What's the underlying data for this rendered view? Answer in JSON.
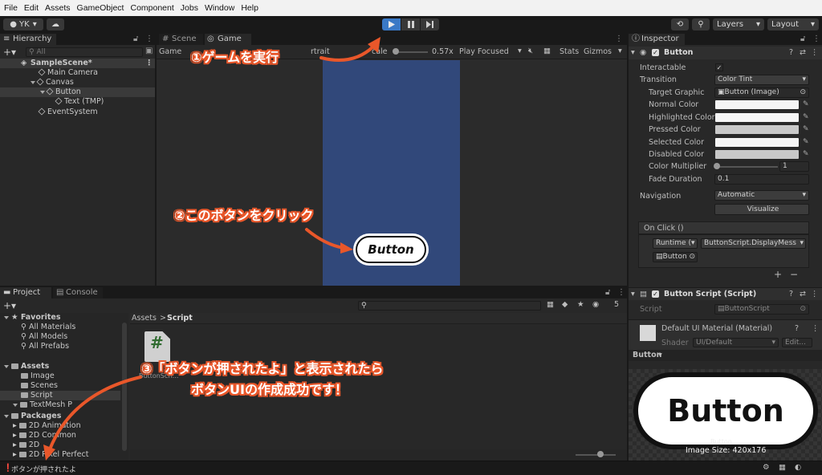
{
  "menu": [
    "File",
    "Edit",
    "Assets",
    "GameObject",
    "Component",
    "Jobs",
    "Window",
    "Help"
  ],
  "toolbar": {
    "account": "YK",
    "layers": "Layers",
    "layout": "Layout",
    "play_icon": "play-icon",
    "pause_icon": "pause-icon",
    "step_icon": "step-icon"
  },
  "hierarchy": {
    "tab": "Hierarchy",
    "search_placeholder": "All",
    "scene": "SampleScene*",
    "items": [
      "Main Camera",
      "Canvas",
      "Button",
      "Text (TMP)",
      "EventSystem"
    ]
  },
  "game_view": {
    "tabs": [
      "Scene",
      "Game"
    ],
    "display_label": "Game",
    "aspect_fragment": "rtrait",
    "scale_label": "cale",
    "scale_value": "0.57x",
    "play_focused": "Play Focused",
    "stats": "Stats",
    "gizmos": "Gizmos",
    "button_text": "Button",
    "canvas_color": "#31487a"
  },
  "inspector": {
    "tab": "Inspector",
    "component": "Button",
    "interactable_label": "Interactable",
    "transition_label": "Transition",
    "transition_value": "Color Tint",
    "target_graphic_label": "Target Graphic",
    "target_graphic_value": "Button (Image)",
    "normal_color": "Normal Color",
    "highlighted_color": "Highlighted Color",
    "pressed_color": "Pressed Color",
    "selected_color": "Selected Color",
    "disabled_color": "Disabled Color",
    "color_multiplier": "Color Multiplier",
    "color_multiplier_value": "1",
    "fade_duration": "Fade Duration",
    "fade_duration_value": "0.1",
    "navigation_label": "Navigation",
    "navigation_value": "Automatic",
    "visualize": "Visualize",
    "onclick_header": "On Click ()",
    "runtime": "Runtime (",
    "function": "ButtonScript.DisplayMess",
    "object": "Button",
    "plus": "+",
    "minus": "−",
    "script_component": "Button Script (Script)",
    "script_label": "Script",
    "script_value": "ButtonScript",
    "material": "Default UI Material (Material)",
    "shader_label": "Shader",
    "shader_value": "UI/Default",
    "edit": "Edit...",
    "preview_label": "Button",
    "preview_button_text": "Button",
    "preview_name": "Button",
    "image_size": "Image Size: 420x176"
  },
  "project": {
    "tabs": [
      "Project",
      "Console"
    ],
    "favorites": "Favorites",
    "favorite_items": [
      "All Materials",
      "All Models",
      "All Prefabs"
    ],
    "assets": "Assets",
    "asset_items": [
      "Image",
      "Scenes",
      "Script",
      "TextMesh P"
    ],
    "packages": "Packages",
    "package_items": [
      "2D Animation",
      "2D Common",
      "2D",
      "2D Pixel Perfect"
    ],
    "breadcrumb_root": "Assets",
    "breadcrumb_sep": ">",
    "breadcrumb_current": "Script",
    "file_name": "ButtonScri...",
    "hidden_count": "5"
  },
  "status_bar": "ボタンが押されたよ",
  "annotations": {
    "step1": "①ゲームを実行",
    "step2": "②このボタンをクリック",
    "step3_line1": "③「ボタンが押されたよ」と表示されたら",
    "step3_line2": "ボタンUIの作成成功です！"
  },
  "colors": {
    "annotation": "#e9572a",
    "play_active": "#3a79c6"
  }
}
